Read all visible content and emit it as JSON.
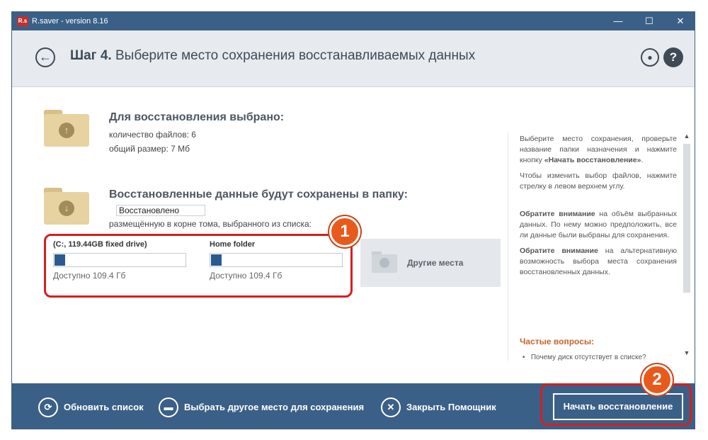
{
  "window": {
    "title": "R.saver - version 8.16",
    "app_icon": "R.s",
    "controls": {
      "minimize": "—",
      "maximize": "☐",
      "close": "✕"
    }
  },
  "header": {
    "step_label": "Шаг 4.",
    "step_title": "Выберите место сохранения восстанавливаемых данных"
  },
  "selection": {
    "title": "Для восстановления выбрано:",
    "file_count": "количество файлов: 6",
    "total_size": "общий размер: 7 Мб"
  },
  "destination": {
    "title": "Восстановленные данные будут сохранены в папку:",
    "folder_name": "Восстановлено",
    "hint": "размещённую в корне тома, выбранного из списка:"
  },
  "drives": [
    {
      "title": "(C:, 119.44GB fixed drive)",
      "free": "Доступно 109.4 Гб",
      "used_fraction": 0.08
    },
    {
      "title": "Home folder",
      "free": "Доступно 109.4 Гб",
      "used_fraction": 0.08
    }
  ],
  "other_places": {
    "label": "Другие места"
  },
  "help": {
    "p1_prefix": "Выберите место сохранения, проверьте название папки назначения и нажмите кнопку ",
    "p1_bold": "«Начать восстановление»",
    "p1_suffix": ".",
    "p2": "Чтобы изменить выбор файлов, нажмите стрелку в левом верхнем углу.",
    "p3_bold": "Обратите внимание",
    "p3": " на объём выбранных данных. По нему можно предположить, все ли данные были выбраны для сохранения.",
    "p4_bold": "Обратите внимание",
    "p4": " на альтернативную возможность выбора места сохранения восстановленных данных.",
    "faq_title": "Частые вопросы:",
    "faq_item": "Почему диск отсутствует в списке?"
  },
  "footer": {
    "refresh": "Обновить список",
    "choose_other": "Выбрать другое место для сохранения",
    "close_wizard": "Закрыть Помощник",
    "start": "Начать восстановление"
  },
  "annotations": {
    "marker1": "1",
    "marker2": "2"
  },
  "colors": {
    "titlebar": "#3b6087",
    "highlight": "#d61f1f",
    "marker": "#e85a1c"
  }
}
